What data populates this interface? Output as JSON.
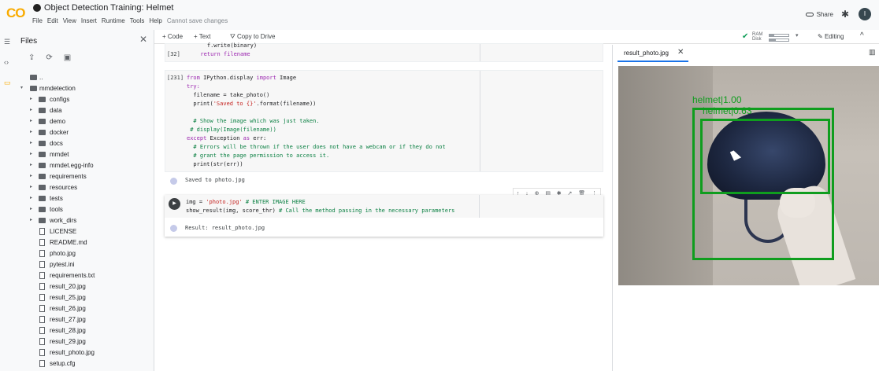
{
  "app": {
    "logo": "CO",
    "title": "Object Detection Training: Helmet",
    "menu": [
      "File",
      "Edit",
      "View",
      "Insert",
      "Runtime",
      "Tools",
      "Help"
    ],
    "save_note": "Cannot save changes",
    "share_label": "Share",
    "avatar_letter": "I"
  },
  "toolbar": {
    "add_code": "+ Code",
    "add_text": "+ Text",
    "copy_drive": "Copy to Drive",
    "ram_label": "RAM",
    "disk_label": "Disk",
    "ram_fill": 0.25,
    "disk_fill": 0.35,
    "editing_label": "Editing"
  },
  "files": {
    "title": "Files",
    "parent": "..",
    "root": "mmdetection",
    "folders": [
      "configs",
      "data",
      "demo",
      "docker",
      "docs",
      "mmdet",
      "mmdet.egg-info",
      "requirements",
      "resources",
      "tests",
      "tools",
      "work_dirs"
    ],
    "files": [
      "LICENSE",
      "README.md",
      "photo.jpg",
      "pytest.ini",
      "requirements.txt",
      "result_20.jpg",
      "result_25.jpg",
      "result_26.jpg",
      "result_27.jpg",
      "result_28.jpg",
      "result_29.jpg",
      "result_photo.jpg",
      "setup.cfg"
    ]
  },
  "notebook": {
    "cell1": {
      "num": "[32]",
      "line0": "    f.write(binary)",
      "line1": "  return filename"
    },
    "cell2": {
      "num": "[231]",
      "l1_from": "from",
      "l1_mod": " IPython.display ",
      "l1_import": "import",
      "l1_name": " Image",
      "l2_try": "try:",
      "l3": "  filename = take_photo()",
      "l4_pre": "  print(",
      "l4_str": "'Saved to {}'",
      "l4_post": ".format(filename))",
      "l5": "  # Show the image which was just taken.",
      "l6": " # display(Image(filename))",
      "l7_except": "except",
      "l7_exc": " Exception ",
      "l7_as": "as",
      "l7_err": " err:",
      "l8": "  # Errors will be thrown if the user does not have a webcam or if they do not",
      "l9": "  # grant the page permission to access it.",
      "l10": "  print(str(err))",
      "output": "Saved to photo.jpg"
    },
    "cell3": {
      "l1_pre": "img = ",
      "l1_str": "'photo.jpg'",
      "l1_com": " # ENTER IMAGE HERE",
      "l2_pre": "show_result(img, score_thr)",
      "l2_com": " # Call the method passing in the necessary parameters",
      "output": "Result:  result_photo.jpg"
    },
    "cell_toolbar": [
      "↑",
      "↓",
      "⊕",
      "▤",
      "✱",
      "↗",
      "🗑",
      "⋮"
    ]
  },
  "viewer": {
    "tab": "result_photo.jpg",
    "detections": [
      {
        "label": "helmet|1.00",
        "color": "#0f9d1e"
      },
      {
        "label": "helmet|0.63",
        "color": "#0f9d1e"
      }
    ]
  },
  "colors": {
    "accent": "#f9ab00",
    "box": "#0f9d1e",
    "tab_underline": "#1a73e8"
  }
}
